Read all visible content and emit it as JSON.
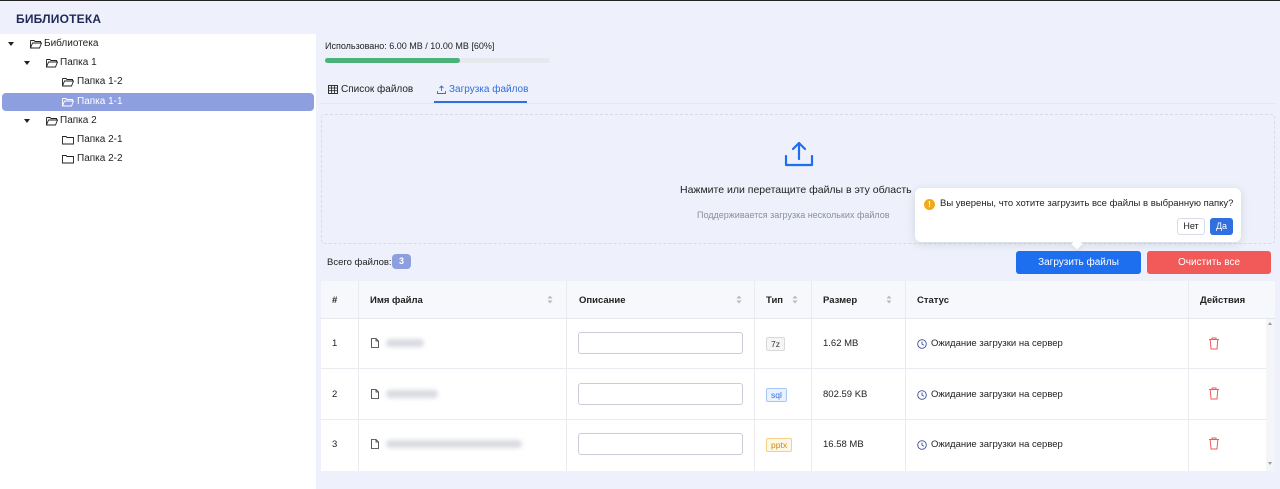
{
  "app": {
    "title": "БИБЛИОТЕКА"
  },
  "sidebar": {
    "nodes": [
      {
        "label": "Библиотека",
        "expanded": true,
        "selected": false,
        "icon": "folder-open-icon"
      },
      {
        "label": "Папка 1",
        "expanded": true,
        "selected": false,
        "icon": "folder-open-icon"
      },
      {
        "label": "Папка 1-2",
        "expanded": false,
        "selected": false,
        "icon": "folder-open-icon"
      },
      {
        "label": "Папка 1-1",
        "expanded": false,
        "selected": true,
        "icon": "folder-open-icon"
      },
      {
        "label": "Папка 2",
        "expanded": true,
        "selected": false,
        "icon": "folder-open-icon"
      },
      {
        "label": "Папка 2-1",
        "expanded": false,
        "selected": false,
        "icon": "folder-icon"
      },
      {
        "label": "Папка 2-2",
        "expanded": false,
        "selected": false,
        "icon": "folder-icon"
      }
    ]
  },
  "usage": {
    "text": "Использовано: 6.00 MB / 10.00 MB [60%]",
    "fraction": 0.6,
    "color": "#49b379"
  },
  "tabs": [
    {
      "label": "Список файлов",
      "icon": "table-icon",
      "active": false
    },
    {
      "label": "Загрузка файлов",
      "icon": "upload-small-icon",
      "active": true
    }
  ],
  "dropzone": {
    "title": "Нажмите или перетащите файлы в эту область",
    "hint": "Поддерживается загрузка нескольких файлов",
    "icon": "upload-icon"
  },
  "popconfirm": {
    "message": "Вы уверены, что хотите загрузить все файлы в выбранную папку?",
    "no_label": "Нет",
    "yes_label": "Да",
    "icon": "warning-icon"
  },
  "summary": {
    "total_label": "Всего файлов:",
    "total_count": "3"
  },
  "buttons": {
    "upload_label": "Загрузить файлы",
    "clear_label": "Очистить все"
  },
  "colors": {
    "accent": "#2f6fe0",
    "danger": "#f25a5a",
    "selected_bg": "#8e9fdf"
  },
  "table": {
    "headers": {
      "num": "#",
      "name": "Имя файла",
      "desc": "Описание",
      "type": "Тип",
      "size": "Размер",
      "status": "Статус",
      "actions": "Действия"
    },
    "rows": [
      {
        "num": "1",
        "type": "7z",
        "size": "1.62 MB",
        "status": "Ожидание загрузки на сервер",
        "description": ""
      },
      {
        "num": "2",
        "type": "sql",
        "size": "802.59 KB",
        "status": "Ожидание загрузки на сервер",
        "description": ""
      },
      {
        "num": "3",
        "type": "pptx",
        "size": "16.58 MB",
        "status": "Ожидание загрузки на сервер",
        "description": ""
      }
    ]
  }
}
